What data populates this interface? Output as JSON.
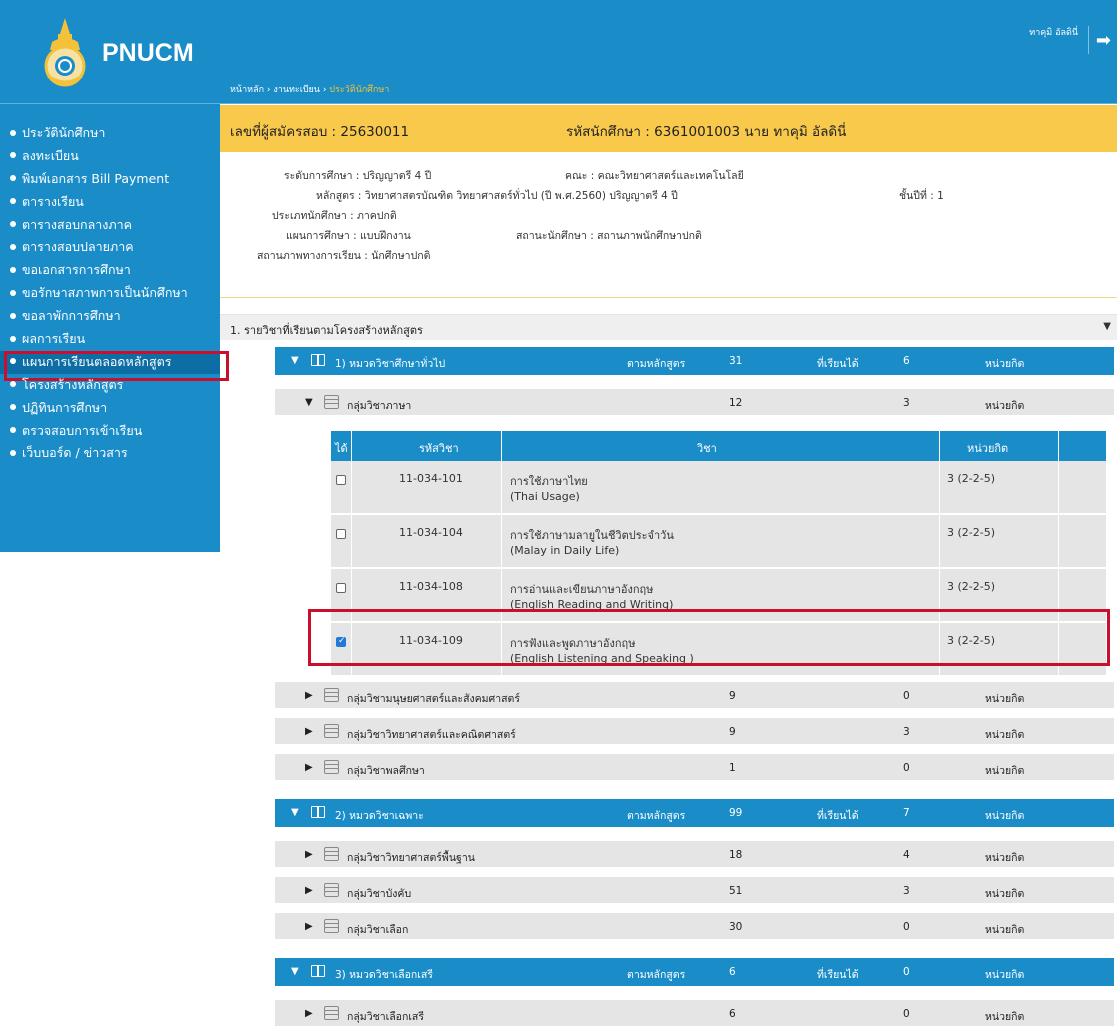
{
  "app": {
    "brand": "PNUCM"
  },
  "header": {
    "username": "ทาคุมิ อัลดินี่",
    "breadcrumb": {
      "home": "หน้าหลัก",
      "sep1": " › ",
      "mid": "งานทะเบียน",
      "sep2": " › ",
      "current": "ประวัตินักศึกษา"
    }
  },
  "sidebar": {
    "items": [
      {
        "label": "ประวัตินักศึกษา"
      },
      {
        "label": "ลงทะเบียน"
      },
      {
        "label": "พิมพ์เอกสาร Bill Payment"
      },
      {
        "label": "ตารางเรียน"
      },
      {
        "label": "ตารางสอบกลางภาค"
      },
      {
        "label": "ตารางสอบปลายภาค"
      },
      {
        "label": "ขอเอกสารการศึกษา"
      },
      {
        "label": "ขอรักษาสภาพการเป็นนักศึกษา"
      },
      {
        "label": "ขอลาพักการศึกษา"
      },
      {
        "label": "ผลการเรียน"
      },
      {
        "label": "แผนการเรียนตลอดหลักสูตร"
      },
      {
        "label": "โครงสร้างหลักสูตร"
      },
      {
        "label": "ปฏิทินการศึกษา"
      },
      {
        "label": "ตรวจสอบการเข้าเรียน"
      },
      {
        "label": "เว็บบอร์ด / ข่าวสาร"
      }
    ]
  },
  "student": {
    "applicant": "เลขที่ผู้สมัครสอบ : 25630011",
    "student_id": "รหัสนักศึกษา : 6361001003 นาย ทาคุมิ อัลดินี่",
    "level": "ระดับการศึกษา : ปริญญาตรี 4 ปี",
    "faculty": "คณะ : คณะวิทยาศาสตร์และเทคโนโลยี",
    "program": "หลักสูตร : วิทยาศาสตรบัณฑิต วิทยาศาสตร์ทั่วไป (ปี พ.ศ.2560) ปริญญาตรี 4 ปี",
    "year": "ชั้นปีที่ : 1",
    "type": "ประเภทนักศึกษา : ภาคปกติ",
    "plan": "แผนการศึกษา : แบบฝึกงาน",
    "status": "สถานะนักศึกษา : สถานภาพนักศึกษาปกติ",
    "study_status": "สถานภาพทางการเรียน : นักศึกษาปกติ"
  },
  "section": {
    "title": "1. รายวิชาที่เรียนตามโครงสร้างหลักสูตร",
    "arrow": "▼"
  },
  "labels": {
    "by_curriculum": "ตามหลักสูตร",
    "studied": "ที่เรียนได้",
    "credit": "หน่วยกิต",
    "expanded": "▼",
    "collapsed": "▶"
  },
  "categories": [
    {
      "name": "1) หมวดวิชาศึกษาทั่วไป",
      "required": "31",
      "earned": "6"
    },
    {
      "name": "2) หมวดวิชาเฉพาะ",
      "required": "99",
      "earned": "7"
    },
    {
      "name": "3) หมวดวิชาเลือกเสรี",
      "required": "6",
      "earned": "0"
    }
  ],
  "groups": [
    {
      "name": "กลุ่มวิชาภาษา",
      "required": "12",
      "earned": "3"
    },
    {
      "name": "กลุ่มวิชามนุษยศาสตร์และสังคมศาสตร์",
      "required": "9",
      "earned": "0"
    },
    {
      "name": "กลุ่มวิชาวิทยาศาสตร์และคณิตศาสตร์",
      "required": "9",
      "earned": "3"
    },
    {
      "name": "กลุ่มวิชาพลศึกษา",
      "required": "1",
      "earned": "0"
    },
    {
      "name": "กลุ่มวิชาวิทยาศาสตร์พื้นฐาน",
      "required": "18",
      "earned": "4"
    },
    {
      "name": "กลุ่มวิชาบังคับ",
      "required": "51",
      "earned": "3"
    },
    {
      "name": "กลุ่มวิชาเลือก",
      "required": "30",
      "earned": "0"
    },
    {
      "name": "กลุ่มวิชาเลือกเสรี",
      "required": "6",
      "earned": "0"
    }
  ],
  "course_table": {
    "headers": {
      "got": "ได้",
      "code": "รหัสวิชา",
      "subject": "วิชา",
      "credit": "หน่วยกิต"
    },
    "rows": [
      {
        "checked": false,
        "code": "11-034-101",
        "name_th": "การใช้ภาษาไทย",
        "name_en": "(Thai Usage)",
        "credit": "3 (2-2-5)"
      },
      {
        "checked": false,
        "code": "11-034-104",
        "name_th": "การใช้ภาษามลายูในชีวิตประจำวัน",
        "name_en": "(Malay in Daily Life)",
        "credit": "3 (2-2-5)"
      },
      {
        "checked": false,
        "code": "11-034-108",
        "name_th": "การอ่านและเขียนภาษาอังกฤษ",
        "name_en": "(English Reading and Writing)",
        "credit": "3 (2-2-5)"
      },
      {
        "checked": true,
        "code": "11-034-109",
        "name_th": "การฟังและพูดภาษาอังกฤษ",
        "name_en": "(English Listening and Speaking )",
        "credit": "3 (2-2-5)"
      }
    ]
  },
  "colors": {
    "primary": "#1a8cc8",
    "accent": "#f9c94c",
    "highlight": "#c8102e"
  }
}
